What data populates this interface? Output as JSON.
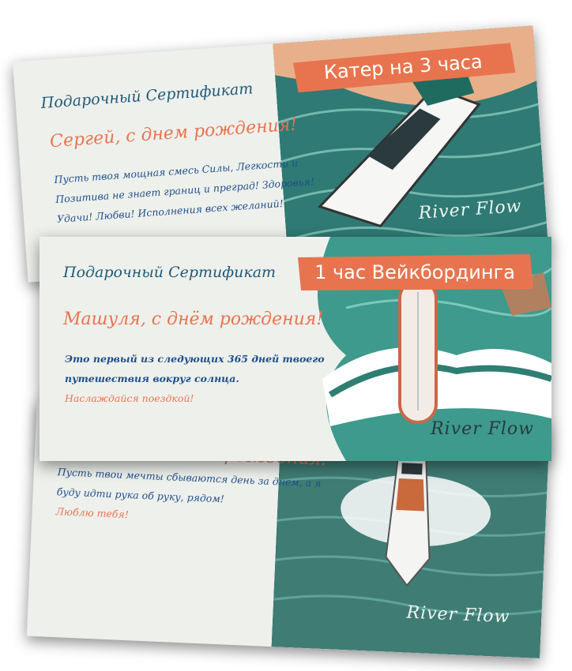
{
  "cards": [
    {
      "cert_title": "Подарочный Сертификат",
      "greeting": "Сергей, с днем рождения!",
      "message_lines": [
        "Пусть твоя мощная смесь Силы, Легкости и",
        "Позитива не знает границ и преград! Здоровья!",
        "Удачи! Любви! Исполнения всех желаний!"
      ],
      "banner": "Катер на 3 часа",
      "brand": "River Flow"
    },
    {
      "cert_title": "Подарочный Сертификат",
      "greeting": "Машуля, с днём рождения!",
      "message_lines": [
        "Это первый из следующих 365 дней твоего",
        "путешествия вокруг солнца."
      ],
      "closing": "Наслаждайся поездкой!",
      "banner": "1 час Вейкбординга",
      "brand": "River Flow"
    },
    {
      "greeting_partial": "рождения!",
      "message_lines": [
        "Пусть твои мечты сбываются день за днем, а я",
        "буду идти рука об руку, рядом!"
      ],
      "closing": "Люблю тебя!",
      "brand": "River Flow"
    }
  ],
  "colors": {
    "accent": "#e8744f",
    "title_blue": "#1e5a78",
    "text_blue": "#1e4f8a",
    "sea": "#2f8a80",
    "card_bg": "#eef0ec"
  }
}
